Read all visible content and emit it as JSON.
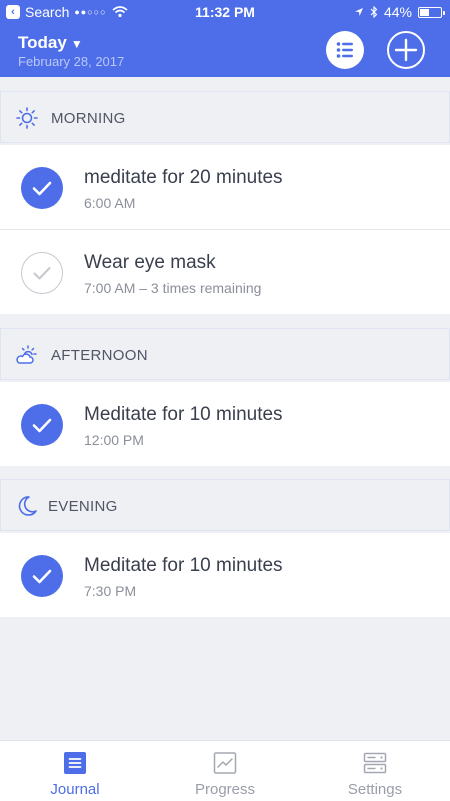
{
  "status_bar": {
    "back_label": "Search",
    "time": "11:32 PM",
    "battery": "44%",
    "battery_level": 0.44
  },
  "header": {
    "title": "Today",
    "date": "February 28, 2017",
    "accent_color": "#4d6ee8"
  },
  "sections": [
    {
      "title": "MORNING",
      "icon": "sun-icon",
      "tasks": [
        {
          "title": "meditate for 20 minutes",
          "subtitle": "6:00 AM",
          "done": true
        },
        {
          "title": "Wear eye mask",
          "subtitle": "7:00 AM – 3 times remaining",
          "done": false
        }
      ]
    },
    {
      "title": "AFTERNOON",
      "icon": "partly-cloudy-icon",
      "tasks": [
        {
          "title": "Meditate for 10 minutes",
          "subtitle": "12:00 PM",
          "done": true
        }
      ]
    },
    {
      "title": "EVENING",
      "icon": "moon-icon",
      "tasks": [
        {
          "title": "Meditate for 10 minutes",
          "subtitle": "7:30 PM",
          "done": true
        }
      ]
    }
  ],
  "tabs": [
    {
      "label": "Journal",
      "icon": "journal-icon",
      "active": true
    },
    {
      "label": "Progress",
      "icon": "chart-icon",
      "active": false
    },
    {
      "label": "Settings",
      "icon": "settings-icon",
      "active": false
    }
  ]
}
